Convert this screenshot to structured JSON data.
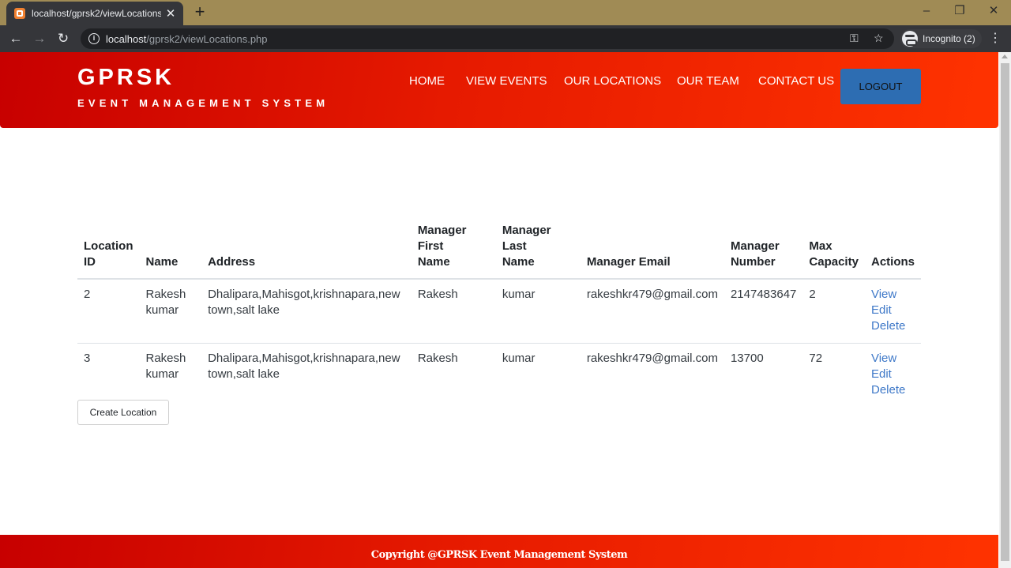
{
  "browser": {
    "tab_title": "localhost/gprsk2/viewLocations.p",
    "url_host": "localhost",
    "url_path": "/gprsk2/viewLocations.php",
    "incognito_label": "Incognito (2)"
  },
  "header": {
    "brand": "GPRSK",
    "tagline": "EVENT MANAGEMENT SYSTEM",
    "nav": [
      "HOME",
      "VIEW EVENTS",
      "OUR LOCATIONS",
      "OUR TEAM",
      "CONTACT US"
    ],
    "logout_label": "LOGOUT"
  },
  "table": {
    "headers": {
      "location_id": [
        "Location",
        "ID"
      ],
      "name": "Name",
      "address": "Address",
      "manager_first": [
        "Manager First",
        "Name"
      ],
      "manager_last": [
        "Manager Last",
        "Name"
      ],
      "manager_email": "Manager Email",
      "manager_number": [
        "Manager",
        "Number"
      ],
      "max_capacity": [
        "Max",
        "Capacity"
      ],
      "actions": "Actions"
    },
    "rows": [
      {
        "id": "2",
        "name": [
          "Rakesh",
          "kumar"
        ],
        "address": [
          "Dhalipara,Mahisgot,krishnapara,new",
          "town,salt lake"
        ],
        "first": "Rakesh",
        "last": "kumar",
        "email": "rakeshkr479@gmail.com",
        "number": "2147483647",
        "capacity": "2",
        "actions": [
          "View",
          "Edit",
          "Delete"
        ]
      },
      {
        "id": "3",
        "name": [
          "Rakesh",
          "kumar"
        ],
        "address": [
          "Dhalipara,Mahisgot,krishnapara,new",
          "town,salt lake"
        ],
        "first": "Rakesh",
        "last": "kumar",
        "email": "rakeshkr479@gmail.com",
        "number": "13700",
        "capacity": "72",
        "actions": [
          "View",
          "Edit",
          "Delete"
        ]
      }
    ]
  },
  "create_label": "Create Location",
  "footer_text": "Copyright @GPRSK Event Management System",
  "colors": {
    "header_red": "#e61a00",
    "logout_blue": "#2d6db2",
    "link_blue": "#3e78c8"
  }
}
